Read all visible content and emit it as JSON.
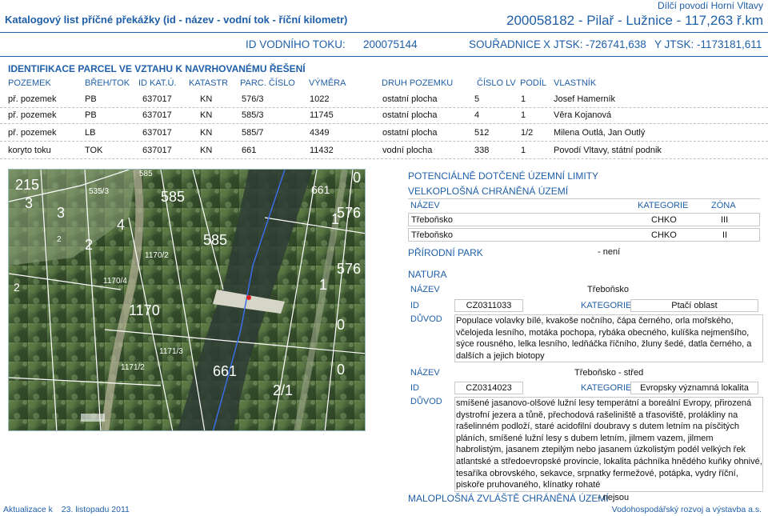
{
  "header": {
    "doc_title": "Katalogový list příčné překážky (id - název - vodní tok - říční kilometr)",
    "region": "Dílčí povodí Horní Vltavy",
    "object_title": "200058182 - Pilař - Lužnice - 117,263 ř.km"
  },
  "stream": {
    "id_label": "ID VODNÍHO TOKU:",
    "id_value": "200075144",
    "coords_label": "SOUŘADNICE",
    "x_label": "X JTSK:",
    "x_value": "-726741,638",
    "y_label": "Y JTSK:",
    "y_value": "-1173181,611"
  },
  "parcels": {
    "heading": "IDENTIFIKACE PARCEL VE VZTAHU K NAVRHOVANÉMU ŘEŠENÍ",
    "columns": [
      "POZEMEK",
      "BŘEH/TOK",
      "ID KAT.Ú.",
      "KATASTR",
      "PARC. ČÍSLO",
      "VÝMĚRA",
      "DRUH POZEMKU",
      "ČÍSLO LV",
      "PODÍL",
      "VLASTNÍK"
    ],
    "rows": [
      [
        "př. pozemek",
        "PB",
        "637017",
        "KN",
        "576/3",
        "1022",
        "ostatní plocha",
        "5",
        "1",
        "Josef Hamerník"
      ],
      [
        "př. pozemek",
        "PB",
        "637017",
        "KN",
        "585/3",
        "11745",
        "ostatní plocha",
        "4",
        "1",
        "Věra Kojanová"
      ],
      [
        "př. pozemek",
        "LB",
        "637017",
        "KN",
        "585/7",
        "4349",
        "ostatní plocha",
        "512",
        "1/2",
        "Milena Outlá, Jan Outlý"
      ],
      [
        "koryto toku",
        "TOK",
        "637017",
        "KN",
        "661",
        "11432",
        "vodní plocha",
        "338",
        "1",
        "Povodí Vltavy, státní podnik"
      ]
    ]
  },
  "map": {
    "labels": [
      "215",
      "3",
      "585",
      "535/3",
      "585",
      "585",
      "576",
      "661",
      "1170",
      "1170/2",
      "1170/4",
      "1171/3",
      "1171/2",
      "661",
      "2",
      "576",
      "3",
      "1",
      "2",
      "0",
      "0",
      "0",
      "4",
      "2/1",
      "1",
      "2"
    ]
  },
  "limits": {
    "title": "POTENCIÁLNĚ DOTČENÉ ÚZEMNÍ LIMITY",
    "vcho": {
      "title": "VELKOPLOŠNÁ CHRÁNĚNÁ ÚZEMÍ",
      "col_name": "NÁZEV",
      "col_category": "KATEGORIE",
      "col_zone": "ZÓNA",
      "rows": [
        {
          "name": "Třeboňsko",
          "category": "CHKO",
          "zone": "III"
        },
        {
          "name": "Třeboňsko",
          "category": "CHKO",
          "zone": "II"
        }
      ]
    },
    "park": {
      "title": "PŘÍRODNÍ PARK",
      "value": "- není"
    },
    "natura": {
      "title": "NATURA",
      "name_label": "NÁZEV",
      "id_label": "ID",
      "category_label": "KATEGORIE",
      "reason_label": "DŮVOD",
      "entries": [
        {
          "name": "Třeboňsko",
          "id": "CZ0311033",
          "category": "Ptačí oblast",
          "reason": "Populace volavky bílé, kvakoše nočního, čápa černého, orla mořského, včelojeda lesního, motáka pochopa, rybáka obecného, kulíška nejmenšího, sýce rousného, lelka lesního, ledňáčka říčního, žluny šedé, datla černého, a dalších a jejich biotopy"
        },
        {
          "name": "Třeboňsko - střed",
          "id": "CZ0314023",
          "category": "Evropsky významná lokalita",
          "reason": "smíšené jasanovo-olšové lužní lesy temperátní a boreální Evropy, přirozená dystrofní jezera a tůně, přechodová rašeliniště a třasoviště, prolákliny na rašelinném podloží, staré acidofilní doubravy s dutem letním na písčitých pláních, smíšené lužní lesy s dubem letním, jilmem vazem, jilmem habrolistým, jasanem ztepilým nebo jasanem úzkolistým podél velkých řek atlantské a středoevropské provincie, lokalita páchníka hnědého kuňky ohnivé, tesaříka obrovského, sekavce, srpnatky fermežové, potápka, vydry říční, piskoře pruhovaného, klínatky rohaté"
        }
      ]
    },
    "mzchu": {
      "title": "MALOPLOŠNÁ ZVLÁŠTĚ CHRÁNĚNÁ ÚZEMÍ",
      "value": "- nejsou"
    }
  },
  "footer": {
    "update_label": "Aktualizace k",
    "update_date": "23. listopadu 2011",
    "organization": "Vodohospodářský rozvoj a výstavba a.s."
  },
  "colors": {
    "accent": "#1f5fa8",
    "parcel_line": "#ffffff",
    "river_line": "#3a6ee8",
    "photo_green": "#3f5a32"
  }
}
